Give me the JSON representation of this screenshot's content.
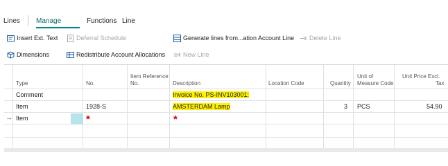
{
  "tabs": {
    "title": "Lines",
    "manage": "Manage",
    "functions": "Functions",
    "line": "Line"
  },
  "actions": {
    "insert_ext_text": "Insert Ext. Text",
    "deferral_schedule": "Deferral Schedule",
    "generate_lines": "Generate lines from...ation Account Line",
    "delete_line": "Delete Line",
    "dimensions": "Dimensions",
    "redistribute": "Redistribute Account Allocations",
    "new_line": "New Line"
  },
  "columns": {
    "type": "Type",
    "no": "No.",
    "item_ref_1": "Item Reference",
    "item_ref_2": "No.",
    "description": "Description",
    "location": "Location Code",
    "quantity": "Quantity",
    "uom_1": "Unit of",
    "uom_2": "Measure Code",
    "price_1": "Unit Price Excl.",
    "price_2": "Tax"
  },
  "rows": [
    {
      "type": "Comment",
      "no": "",
      "description": "Invoice No. PS-INV103001:",
      "quantity": "",
      "uom": "",
      "price": ""
    },
    {
      "type": "Item",
      "no": "1928-S",
      "description": "AMSTERDAM Lamp",
      "quantity": "3",
      "uom": "PCS",
      "price": "54.90"
    },
    {
      "type": "Item",
      "no": "",
      "description": "",
      "quantity": "",
      "uom": "",
      "price": ""
    }
  ],
  "required_marker": "*",
  "current_row_marker": "→",
  "colors": {
    "accent": "#008489",
    "highlight": "#fff200",
    "required": "#d40000"
  }
}
